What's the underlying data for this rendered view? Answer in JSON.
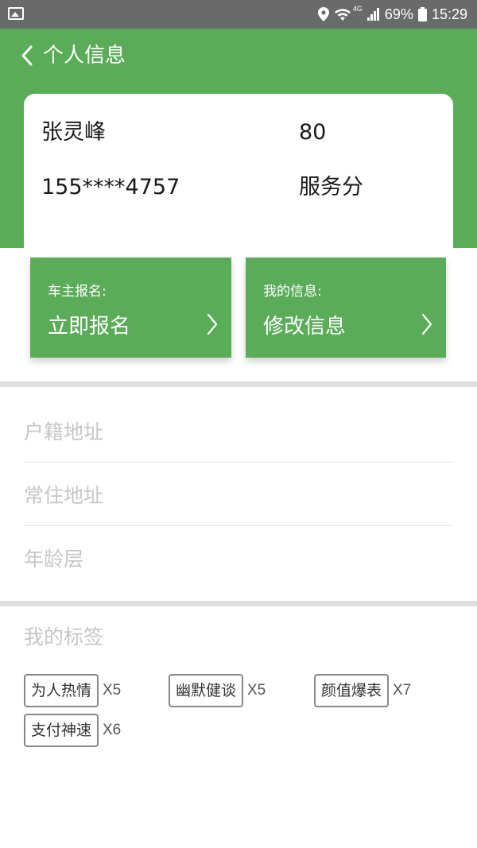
{
  "status_bar": {
    "battery": "69%",
    "time": "15:29",
    "network": "4G"
  },
  "header": {
    "title": "个人信息"
  },
  "profile": {
    "name": "张灵峰",
    "phone": "155****4757",
    "score": "80",
    "score_label": "服务分"
  },
  "actions": [
    {
      "small": "车主报名:",
      "big": "立即报名"
    },
    {
      "small": "我的信息:",
      "big": "修改信息"
    }
  ],
  "fields": [
    {
      "label": "户籍地址"
    },
    {
      "label": "常住地址"
    },
    {
      "label": "年龄层"
    }
  ],
  "tags_section": {
    "title": "我的标签",
    "tags": [
      {
        "label": "为人热情",
        "count": "X5"
      },
      {
        "label": "幽默健谈",
        "count": "X5"
      },
      {
        "label": "颜值爆表",
        "count": "X7"
      },
      {
        "label": "支付神速",
        "count": "X6"
      }
    ]
  },
  "colors": {
    "brand_green": "#5aac58",
    "status_bar": "#6a6a6a"
  }
}
